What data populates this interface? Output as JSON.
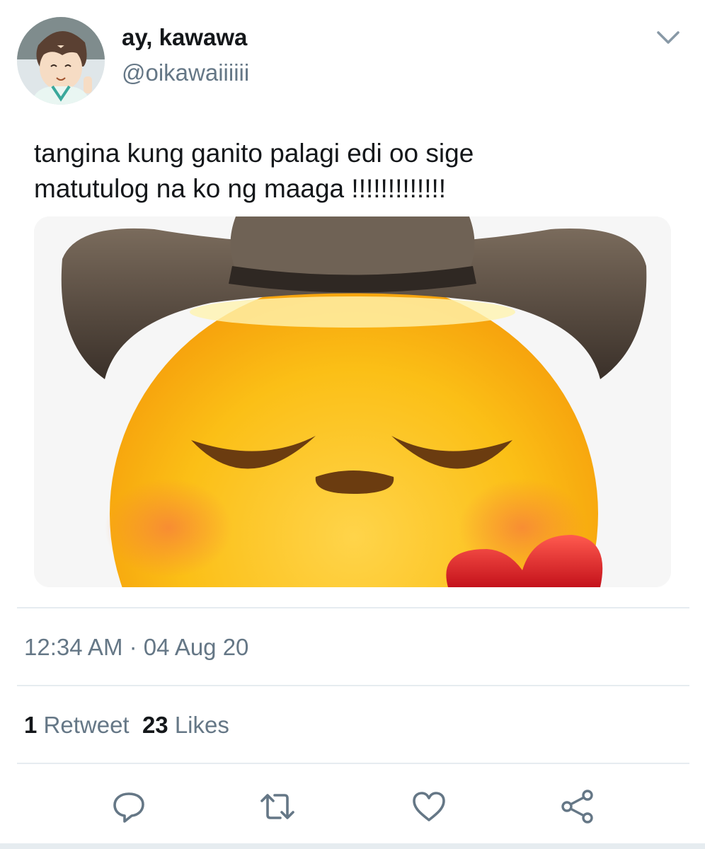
{
  "user": {
    "display_name": "ay, kawawa",
    "handle": "@oikawaiiiiii"
  },
  "tweet": {
    "text": "tangina kung ganito palagi edi oo sige\nmatutulog na ko ng maaga !!!!!!!!!!!!!"
  },
  "meta": {
    "time": "12:34 AM",
    "separator": " · ",
    "date": "04 Aug 20"
  },
  "stats": {
    "retweets_count": "1",
    "retweets_label": "Retweet",
    "likes_count": "23",
    "likes_label": "Likes"
  },
  "actions": {
    "icons": [
      "reply-icon",
      "retweet-icon",
      "like-icon",
      "share-icon"
    ]
  },
  "colors": {
    "text": "#14171a",
    "secondary": "#657786",
    "divider": "#e6ecf0",
    "emoji_yellow": "#fbbf16",
    "hat_brown": "#4a3d32",
    "heart_red": "#e01b24"
  }
}
